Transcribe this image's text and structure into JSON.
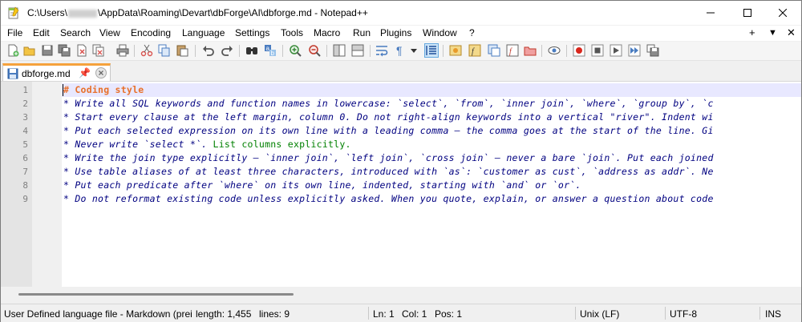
{
  "window": {
    "title_prefix": "C:\\Users\\",
    "title_suffix": "\\AppData\\Roaming\\Devart\\dbForge\\AI\\dbforge.md - Notepad++"
  },
  "menu": {
    "items": [
      "File",
      "Edit",
      "Search",
      "View",
      "Encoding",
      "Language",
      "Settings",
      "Tools",
      "Macro",
      "Run",
      "Plugins",
      "Window",
      "?"
    ],
    "right_plus": "+",
    "right_down": "▼",
    "right_close": "✕"
  },
  "tab": {
    "label": "dbforge.md",
    "pin": "📌"
  },
  "editor": {
    "line_numbers": [
      "1",
      "2",
      "3",
      "4",
      "5",
      "6",
      "7",
      "8",
      "9"
    ],
    "lines": [
      "# Coding style",
      "* Write all SQL keywords and function names in lowercase: `select`, `from`, `inner join`, `where`, `group by`, `c",
      "* Start every clause at the left margin, column 0. Do not right-align keywords into a vertical \"river\". Indent wi",
      "* Put each selected expression on its own line with a leading comma — the comma goes at the start of the line. Gi",
      "* Never write `select *`.",
      "* Write the join type explicitly — `inner join`, `left join`, `cross join` — never a bare `join`. Put each joined",
      "* Use table aliases of at least three characters, introduced with `as`: `customer as cust`, `address as addr`. Ne",
      "* Put each predicate after `where` on its own line, indented, starting with `and` or `or`.",
      "* Do not reformat existing code unless explicitly asked. When you quote, explain, or answer a question about code"
    ],
    "line5_rest": " List columns explicitly."
  },
  "status": {
    "language": "User Defined language file - Markdown (prei",
    "length": "length: 1,455",
    "lines": "lines: 9",
    "ln": "Ln: 1",
    "col": "Col: 1",
    "pos": "Pos: 1",
    "eol": "Unix (LF)",
    "encoding": "UTF-8",
    "mode": "INS"
  },
  "colors": {
    "heading": "#e8702a",
    "emphasis_text": "#000080",
    "plain_text": "#008000",
    "current_line": "#e8e8ff",
    "tab_accent": "#f5a23c"
  },
  "toolbar_icons": [
    "new-file-icon",
    "open-file-icon",
    "save-icon",
    "save-all-icon",
    "close-icon",
    "close-all-icon",
    "print-icon",
    "cut-icon",
    "copy-icon",
    "paste-icon",
    "undo-icon",
    "redo-icon",
    "find-icon",
    "replace-icon",
    "zoom-in-icon",
    "zoom-out-icon",
    "sync-vertical-icon",
    "sync-horizontal-icon",
    "word-wrap-icon",
    "show-all-chars-icon",
    "indent-guide-icon",
    "doc-map-icon",
    "function-list-icon",
    "folder-workspace-icon",
    "monitoring-icon",
    "record-macro-icon",
    "stop-macro-icon",
    "play-macro-icon",
    "run-macro-multiple-icon",
    "save-macro-icon"
  ]
}
